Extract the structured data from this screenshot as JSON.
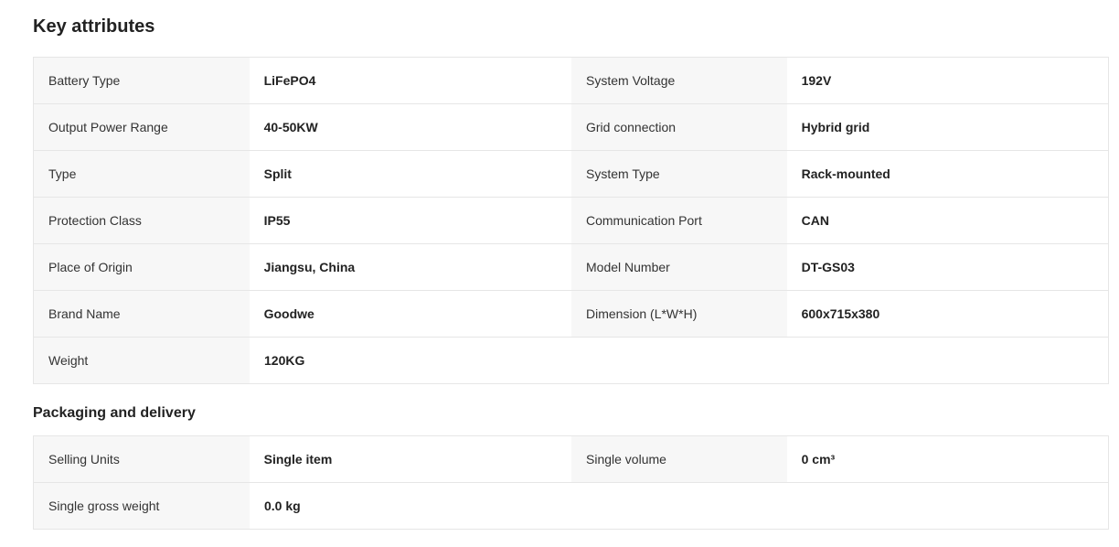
{
  "key_attributes": {
    "title": "Key attributes",
    "rows": [
      {
        "label1": "Battery Type",
        "value1": "LiFePO4",
        "label2": "System Voltage",
        "value2": "192V"
      },
      {
        "label1": "Output Power Range",
        "value1": "40-50KW",
        "label2": "Grid connection",
        "value2": "Hybrid grid"
      },
      {
        "label1": "Type",
        "value1": "Split",
        "label2": "System Type",
        "value2": "Rack-mounted"
      },
      {
        "label1": "Protection Class",
        "value1": "IP55",
        "label2": "Communication Port",
        "value2": "CAN"
      },
      {
        "label1": "Place of Origin",
        "value1": "Jiangsu, China",
        "label2": "Model Number",
        "value2": "DT-GS03"
      },
      {
        "label1": "Brand Name",
        "value1": "Goodwe",
        "label2": "Dimension (L*W*H)",
        "value2": "600x715x380"
      },
      {
        "label1": "Weight",
        "value1": "120KG"
      }
    ]
  },
  "packaging": {
    "title": "Packaging and delivery",
    "rows": [
      {
        "label1": "Selling Units",
        "value1": "Single item",
        "label2": "Single volume",
        "value2": "0 cm³"
      },
      {
        "label1": "Single gross weight",
        "value1": "0.0 kg"
      }
    ]
  }
}
